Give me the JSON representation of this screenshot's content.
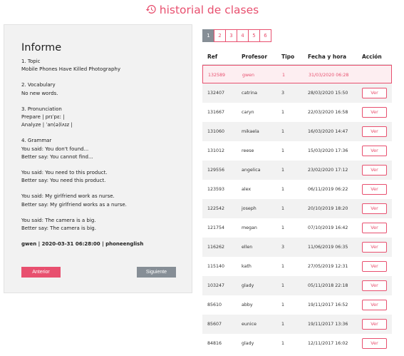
{
  "header": {
    "title": "historial de clases",
    "icon": "history-icon",
    "accent": "#e8506f"
  },
  "report": {
    "title": "Informe",
    "lines": [
      "1. Topic",
      "Mobile Phones Have Killed Photography",
      "",
      "2. Vocabulary",
      "No new words.",
      "",
      "3. Pronunciation",
      "Prepare | prɪˈpɛː |",
      "Analyze | ˈan(ə)lʌɪz |",
      "",
      "4. Grammar",
      "You said: You don't found...",
      "Better say: You cannot find...",
      "",
      "You said: You need to this product.",
      "Better say: You need this product.",
      "",
      "You said: My girlfriend work as nurse.",
      "Better say: My girlfriend works as a nurse.",
      "",
      "You said: The camera is a big.",
      "Better say: The camera is big."
    ],
    "footer": "gwen | 2020-03-31 06:28:00 | phoneenglish",
    "prev_label": "Anterior",
    "next_label": "Siguiente"
  },
  "pagination": {
    "pages": [
      "1",
      "2",
      "3",
      "4",
      "5",
      "6"
    ],
    "active": "1"
  },
  "table": {
    "headers": [
      "Ref",
      "Profesor",
      "Tipo",
      "Fecha y hora",
      "Acción"
    ],
    "action_label": "Ver",
    "rows": [
      {
        "ref": "132589",
        "profesor": "gwen",
        "tipo": "1",
        "fecha": "31/03/2020 06:28",
        "selected": true
      },
      {
        "ref": "132407",
        "profesor": "catrina",
        "tipo": "3",
        "fecha": "28/03/2020 15:50"
      },
      {
        "ref": "131667",
        "profesor": "caryn",
        "tipo": "1",
        "fecha": "22/03/2020 16:58"
      },
      {
        "ref": "131060",
        "profesor": "mikaela",
        "tipo": "1",
        "fecha": "16/03/2020 14:47"
      },
      {
        "ref": "131012",
        "profesor": "reese",
        "tipo": "1",
        "fecha": "15/03/2020 17:36"
      },
      {
        "ref": "129556",
        "profesor": "angelica",
        "tipo": "1",
        "fecha": "23/02/2020 17:12"
      },
      {
        "ref": "123593",
        "profesor": "alex",
        "tipo": "1",
        "fecha": "06/11/2019 06:22"
      },
      {
        "ref": "122542",
        "profesor": "joseph",
        "tipo": "1",
        "fecha": "20/10/2019 18:20"
      },
      {
        "ref": "121754",
        "profesor": "megan",
        "tipo": "1",
        "fecha": "07/10/2019 16:42"
      },
      {
        "ref": "116262",
        "profesor": "ellen",
        "tipo": "3",
        "fecha": "11/06/2019 06:35"
      },
      {
        "ref": "115140",
        "profesor": "kath",
        "tipo": "1",
        "fecha": "27/05/2019 12:31"
      },
      {
        "ref": "103247",
        "profesor": "glady",
        "tipo": "1",
        "fecha": "05/11/2018 22:18"
      },
      {
        "ref": "85610",
        "profesor": "abby",
        "tipo": "1",
        "fecha": "19/11/2017 16:52"
      },
      {
        "ref": "85607",
        "profesor": "eunice",
        "tipo": "1",
        "fecha": "19/11/2017 13:36"
      },
      {
        "ref": "84816",
        "profesor": "glady",
        "tipo": "1",
        "fecha": "12/11/2017 16:02"
      }
    ]
  }
}
